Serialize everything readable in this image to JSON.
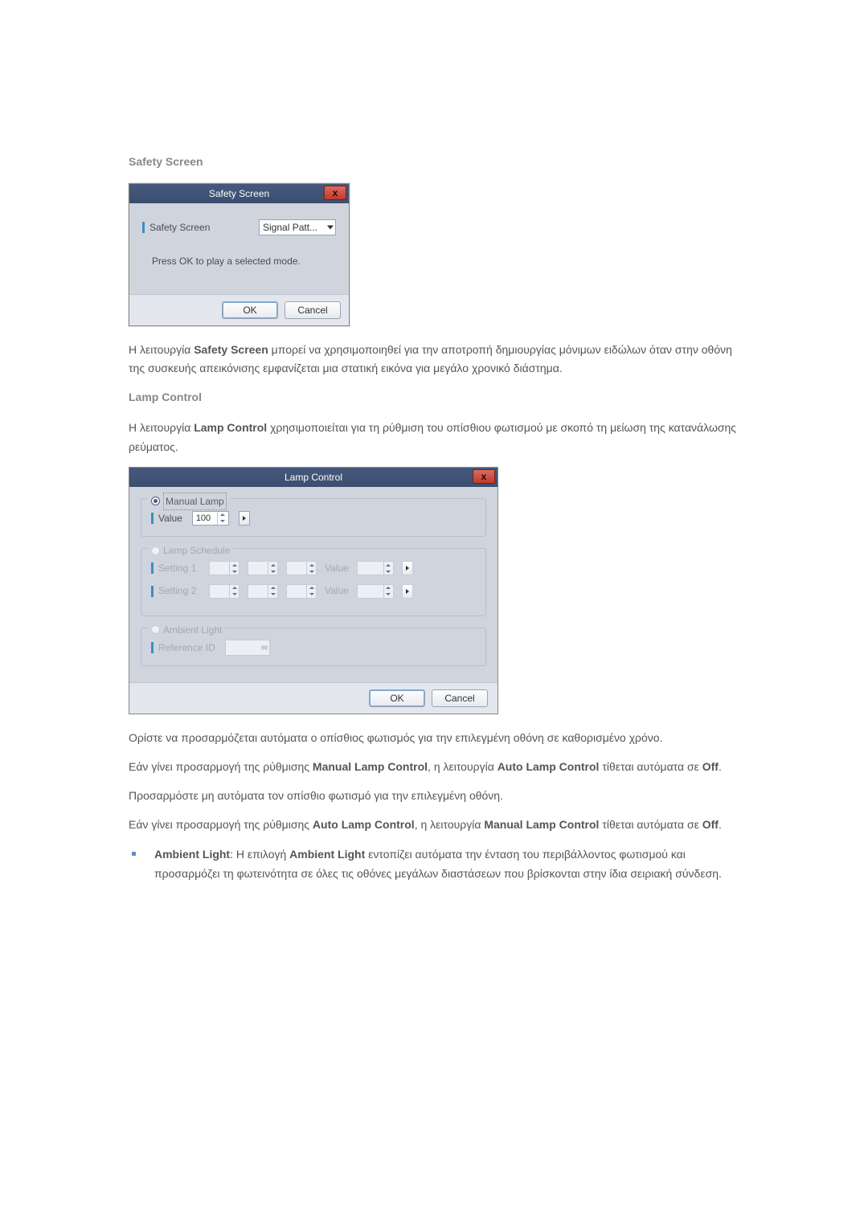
{
  "section1": {
    "heading": "Safety Screen",
    "dialog": {
      "title": "Safety Screen",
      "close": "x",
      "field_label": "Safety Screen",
      "combo_value": "Signal Patt...",
      "hint": "Press OK to play a selected mode.",
      "ok": "OK",
      "cancel": "Cancel"
    },
    "para_parts": {
      "p1a": "Η λειτουργία ",
      "p1b": "Safety Screen",
      "p1c": " μπορεί να χρησιμοποιηθεί για την αποτροπή δημιουργίας μόνιμων ειδώλων όταν στην οθόνη της συσκευής απεικόνισης εμφανίζεται μια στατική εικόνα για μεγάλο χρονικό διάστημα."
    }
  },
  "section2": {
    "heading": "Lamp Control",
    "para_parts": {
      "p1a": "Η λειτουργία ",
      "p1b": "Lamp Control",
      "p1c": " χρησιμοποιείται για τη ρύθμιση του οπίσθιου φωτισμού με σκοπό τη μείωση της κατανάλωσης ρεύματος."
    },
    "dialog": {
      "title": "Lamp Control",
      "close": "x",
      "group_manual": "Manual Lamp",
      "manual_value_label": "Value",
      "manual_value": "100",
      "group_schedule": "Lamp Schedule",
      "schedule_row1_label": "Setting 1",
      "schedule_row2_label": "Setting 2",
      "schedule_value_label": "Value",
      "group_ambient": "Ambient Light",
      "ambient_ref_label": "Reference ID",
      "ok": "OK",
      "cancel": "Cancel"
    },
    "after": {
      "p2": "Ορίστε να προσαρμόζεται αυτόματα ο οπίσθιος φωτισμός για την επιλεγμένη οθόνη σε καθορισμένο χρόνο.",
      "p3a": "Εάν γίνει προσαρμογή της ρύθμισης ",
      "p3b": "Manual Lamp Control",
      "p3c": ", η λειτουργία ",
      "p3d": "Auto Lamp Control",
      "p3e": " τίθεται αυτόματα σε ",
      "p3f": "Off",
      "p3g": ".",
      "p4": "Προσαρμόστε μη αυτόματα τον οπίσθιο φωτισμό για την επιλεγμένη οθόνη.",
      "p5a": "Εάν γίνει προσαρμογή της ρύθμισης ",
      "p5b": "Auto Lamp Control",
      "p5c": ", η λειτουργία ",
      "p5d": "Manual Lamp Control",
      "p5e": " τίθεται αυτόματα σε ",
      "p5f": "Off",
      "p5g": ".",
      "bullet_a": "Ambient Light",
      "bullet_b": ": Η επιλογή ",
      "bullet_c": "Ambient Light",
      "bullet_d": " εντοπίζει αυτόματα την ένταση του περιβάλλοντος φωτισμού και προσαρμόζει τη φωτεινότητα σε όλες τις οθόνες μεγάλων διαστάσεων που βρίσκονται στην ίδια σειριακή σύνδεση."
    }
  }
}
